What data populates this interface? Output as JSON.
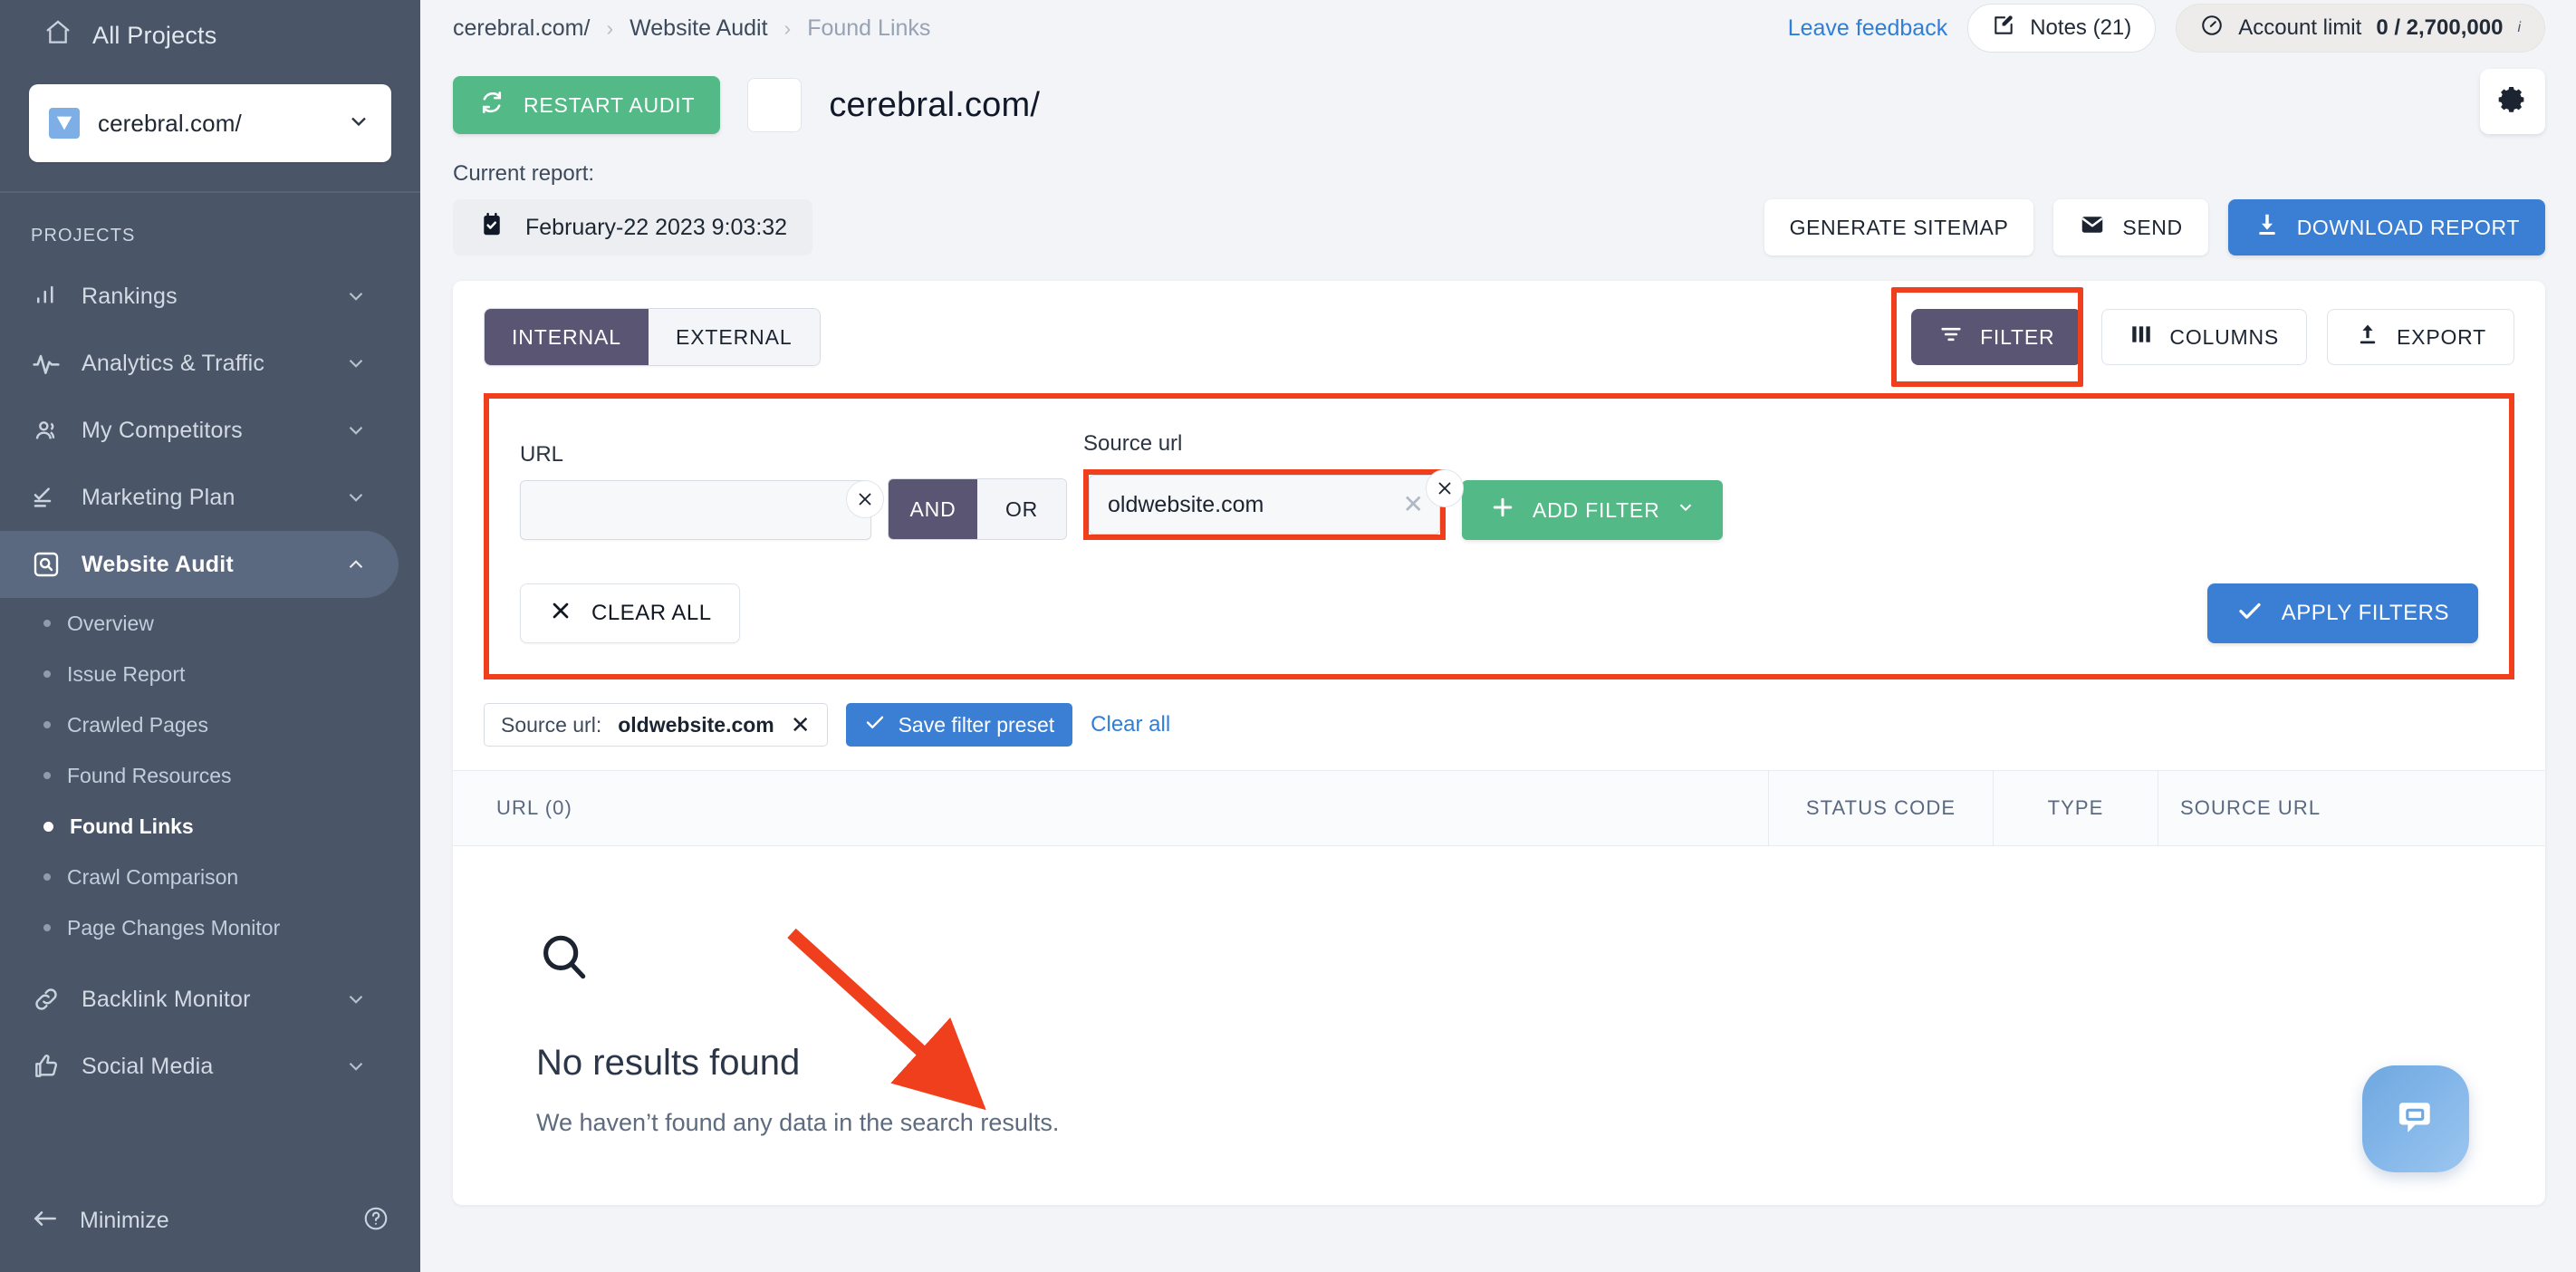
{
  "sidebar": {
    "all_projects": "All Projects",
    "project": "cerebral.com/",
    "section_title": "PROJECTS",
    "nav": [
      {
        "label": "Rankings",
        "icon": "bar-chart-icon",
        "chevron": "down"
      },
      {
        "label": "Analytics & Traffic",
        "icon": "pulse-icon",
        "chevron": "down"
      },
      {
        "label": "My Competitors",
        "icon": "users-icon",
        "chevron": "down"
      },
      {
        "label": "Marketing Plan",
        "icon": "checklist-icon",
        "chevron": "down"
      },
      {
        "label": "Website Audit",
        "icon": "audit-search-icon",
        "chevron": "up",
        "active": true
      }
    ],
    "subnav": [
      {
        "label": "Overview"
      },
      {
        "label": "Issue Report"
      },
      {
        "label": "Crawled Pages"
      },
      {
        "label": "Found Resources"
      },
      {
        "label": "Found Links",
        "active": true
      },
      {
        "label": "Crawl Comparison"
      },
      {
        "label": "Page Changes Monitor"
      }
    ],
    "nav_bottom": [
      {
        "label": "Backlink Monitor",
        "icon": "link-icon",
        "chevron": "down"
      },
      {
        "label": "Social Media",
        "icon": "thumbs-up-icon",
        "chevron": "down"
      }
    ],
    "minimize": "Minimize"
  },
  "topbar": {
    "breadcrumbs": [
      "cerebral.com/",
      "Website Audit",
      "Found Links"
    ],
    "leave_feedback": "Leave feedback",
    "notes": "Notes (21)",
    "account_limit_label": "Account limit",
    "account_limit_value": "0 / 2,700,000"
  },
  "header": {
    "restart_audit": "RESTART AUDIT",
    "site_title": "cerebral.com/"
  },
  "report": {
    "label": "Current report:",
    "date": "February-22 2023 9:03:32",
    "generate_sitemap": "GENERATE SITEMAP",
    "send": "SEND",
    "download_report": "DOWNLOAD REPORT"
  },
  "toolbar": {
    "tabs": [
      {
        "label": "INTERNAL",
        "active": true
      },
      {
        "label": "EXTERNAL",
        "active": false
      }
    ],
    "filter": "FILTER",
    "columns": "COLUMNS",
    "export": "EXPORT"
  },
  "filters": {
    "url_label": "URL",
    "url_value": "",
    "url_placeholder": "",
    "operator_and": "AND",
    "operator_or": "OR",
    "operator_selected": "AND",
    "source_label": "Source url",
    "source_value": "oldwebsite.com",
    "add_filter": "ADD FILTER",
    "clear_all": "CLEAR ALL",
    "apply_filters": "APPLY FILTERS"
  },
  "chips": {
    "token_key": "Source url:",
    "token_value": "oldwebsite.com",
    "save_preset": "Save filter preset",
    "clear_all_link": "Clear all"
  },
  "table": {
    "columns": [
      "URL  (0)",
      "STATUS CODE",
      "TYPE",
      "SOURCE URL"
    ],
    "rows": []
  },
  "empty_state": {
    "icon": "magnifier-icon",
    "title": "No results found",
    "subtitle": "We haven’t found any data in the search results."
  },
  "colors": {
    "sidebar_bg": "#4a5568",
    "accent_purple": "#5a5572",
    "accent_blue": "#3b7fd4",
    "accent_green": "#53b987",
    "highlight_red": "#ef3f1c",
    "page_bg": "#f2f4f7"
  }
}
